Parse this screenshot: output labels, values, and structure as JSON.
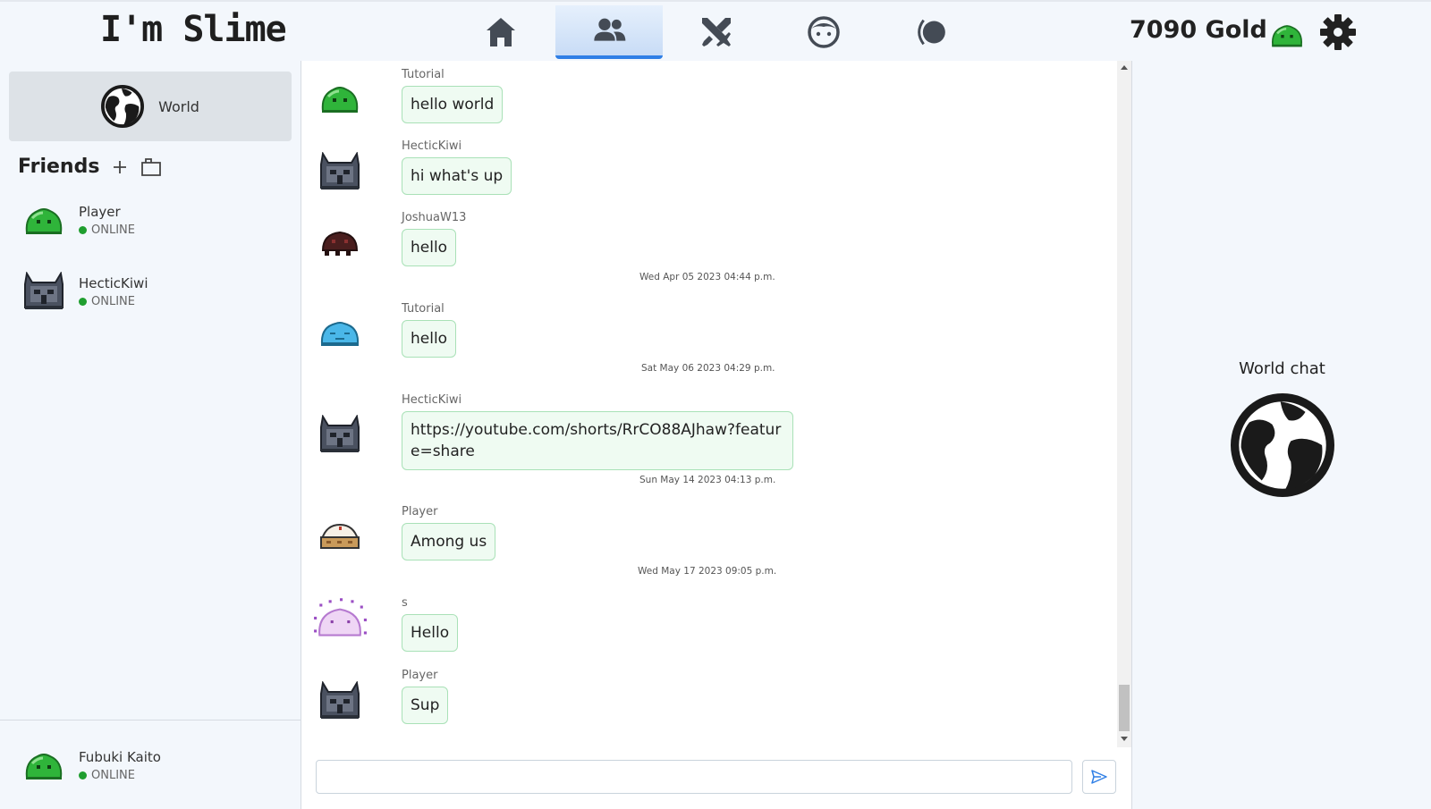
{
  "app": {
    "title": "I'm Slime"
  },
  "nav": {
    "tabs": [
      {
        "name": "home",
        "icon": "home-icon",
        "active": false
      },
      {
        "name": "friends",
        "icon": "users-icon",
        "active": true
      },
      {
        "name": "battle",
        "icon": "crossed-swords-icon",
        "active": false
      },
      {
        "name": "profile",
        "icon": "face-icon",
        "active": false
      },
      {
        "name": "theme",
        "icon": "moon-toggle-icon",
        "active": false
      }
    ]
  },
  "header": {
    "gold": "7090 Gold",
    "accent": "#2f7fe6"
  },
  "sidebar": {
    "world_label": "World",
    "friends_title": "Friends",
    "friends": [
      {
        "name": "Player",
        "status": "ONLINE",
        "avatar": "green-slime"
      },
      {
        "name": "HecticKiwi",
        "status": "ONLINE",
        "avatar": "gray-knight-slime"
      }
    ],
    "self": {
      "name": "Fubuki Kaito",
      "status": "ONLINE",
      "avatar": "green-slime"
    }
  },
  "chat": {
    "messages": [
      {
        "author": "Tutorial",
        "text": "hello world",
        "avatar": "green-slime"
      },
      {
        "author": "HecticKiwi",
        "text": "hi what's up",
        "avatar": "gray-knight-slime"
      },
      {
        "author": "JoshuaW13",
        "text": "hello",
        "avatar": "dark-red-slime"
      },
      {
        "author": "Tutorial",
        "text": "hello",
        "avatar": "blue-slime"
      },
      {
        "author": "HecticKiwi",
        "text": "https://youtube.com/shorts/RrCO88AJhaw?feature=share",
        "avatar": "gray-knight-slime"
      },
      {
        "author": "Player",
        "text": "Among us",
        "avatar": "pie-slime"
      },
      {
        "author": "s",
        "text": "Hello",
        "avatar": "pink-spiky-slime"
      },
      {
        "author": "Player",
        "text": "Sup",
        "avatar": "gray-knight-slime"
      }
    ],
    "timestamps": [
      "Wed Apr 05 2023 04:44 p.m.",
      "Sat May 06 2023 04:29 p.m.",
      "Sun May 14 2023 04:13 p.m.",
      "Wed May 17 2023 09:05 p.m."
    ],
    "input_value": "",
    "input_placeholder": ""
  },
  "right_panel": {
    "label": "World chat"
  },
  "colors": {
    "online": "#1f9e2f",
    "bubble_bg": "#effbf2",
    "bubble_border": "#a9e1b7"
  }
}
